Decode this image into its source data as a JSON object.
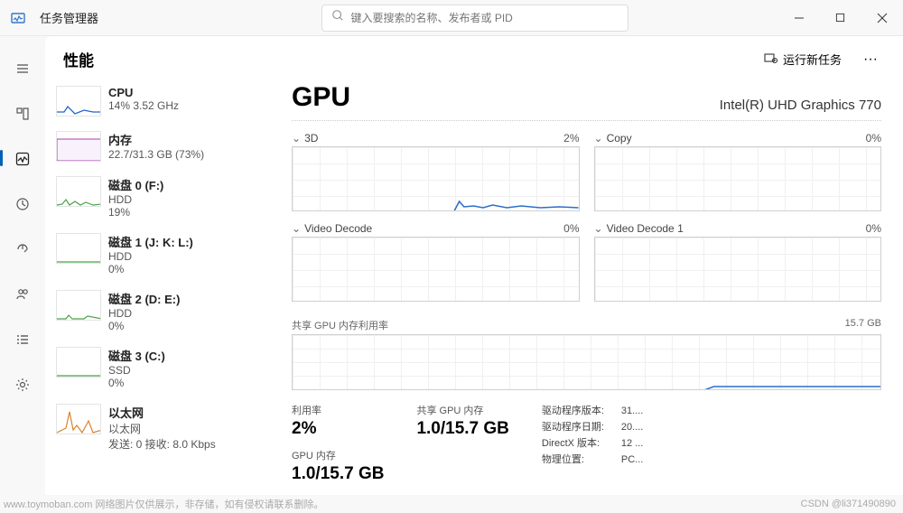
{
  "title": "任务管理器",
  "search": {
    "placeholder": "键入要搜索的名称、发布者或 PID"
  },
  "header": {
    "page_title": "性能",
    "run_new_task": "运行新任务",
    "more": "···"
  },
  "sidebar": [
    {
      "title": "CPU",
      "sub1": "14% 3.52 GHz",
      "sub2": "",
      "color": "#2067c7"
    },
    {
      "title": "内存",
      "sub1": "22.7/31.3 GB (73%)",
      "sub2": "",
      "color": "#a83fb3"
    },
    {
      "title": "磁盘 0 (F:)",
      "sub1": "HDD",
      "sub2": "19%",
      "color": "#4aa24a"
    },
    {
      "title": "磁盘 1 (J: K: L:)",
      "sub1": "HDD",
      "sub2": "0%",
      "color": "#4aa24a"
    },
    {
      "title": "磁盘 2 (D: E:)",
      "sub1": "HDD",
      "sub2": "0%",
      "color": "#4aa24a"
    },
    {
      "title": "磁盘 3 (C:)",
      "sub1": "SSD",
      "sub2": "0%",
      "color": "#4aa24a"
    },
    {
      "title": "以太网",
      "sub1": "以太网",
      "sub2": "发送: 0 接收: 8.0 Kbps",
      "color": "#d9822b"
    }
  ],
  "detail": {
    "title": "GPU",
    "model": "Intel(R) UHD Graphics 770",
    "charts": [
      {
        "name": "3D",
        "pct": "2%"
      },
      {
        "name": "Copy",
        "pct": "0%"
      },
      {
        "name": "Video Decode",
        "pct": "0%"
      },
      {
        "name": "Video Decode 1",
        "pct": "0%"
      }
    ],
    "shared": {
      "label": "共享 GPU 内存利用率",
      "cap": "15.7 GB"
    },
    "stats": [
      {
        "label": "利用率",
        "value": "2%"
      },
      {
        "label": "共享 GPU 内存",
        "value": "1.0/15.7 GB"
      }
    ],
    "stats2": [
      {
        "label": "GPU 内存",
        "value": "1.0/15.7 GB"
      }
    ],
    "props": [
      {
        "k": "驱动程序版本:",
        "v": "31...."
      },
      {
        "k": "驱动程序日期:",
        "v": "20...."
      },
      {
        "k": "DirectX 版本:",
        "v": "12 ..."
      },
      {
        "k": "物理位置:",
        "v": "PC..."
      }
    ]
  },
  "watermark": "www.toymoban.com 网络图片仅供展示，非存储，如有侵权请联系删除。",
  "credit": "CSDN @li371490890",
  "chart_data": {
    "type": "area",
    "title": "GPU engine utilization over 60s",
    "x_range_seconds": 60,
    "y_unit": "%",
    "series": [
      {
        "name": "3D",
        "ylim": [
          0,
          100
        ],
        "values": [
          0,
          0,
          0,
          0,
          0,
          0,
          0,
          0,
          0,
          0,
          0,
          0,
          0,
          0,
          0,
          0,
          0,
          0,
          0,
          0,
          0,
          0,
          0,
          0,
          0,
          0,
          0,
          0,
          0,
          0,
          0,
          0,
          0,
          0,
          0,
          8,
          3,
          5,
          4,
          6,
          4,
          5,
          3,
          4,
          5,
          4,
          3,
          5,
          4,
          4,
          3,
          5,
          3,
          4,
          5,
          4,
          3,
          4,
          4,
          2
        ]
      },
      {
        "name": "Copy",
        "ylim": [
          0,
          100
        ],
        "values": [
          0,
          0,
          0,
          0,
          0,
          0,
          0,
          0,
          0,
          0,
          0,
          0,
          0,
          0,
          0,
          0,
          0,
          0,
          0,
          0,
          0,
          0,
          0,
          0,
          0,
          0,
          0,
          0,
          0,
          0,
          0,
          0,
          0,
          0,
          0,
          0,
          0,
          0,
          0,
          0,
          0,
          0,
          0,
          0,
          0,
          0,
          0,
          0,
          0,
          0,
          0,
          0,
          0,
          0,
          0,
          0,
          0,
          0,
          0,
          0
        ]
      },
      {
        "name": "Video Decode",
        "ylim": [
          0,
          100
        ],
        "values": [
          0,
          0,
          0,
          0,
          0,
          0,
          0,
          0,
          0,
          0,
          0,
          0,
          0,
          0,
          0,
          0,
          0,
          0,
          0,
          0,
          0,
          0,
          0,
          0,
          0,
          0,
          0,
          0,
          0,
          0,
          0,
          0,
          0,
          0,
          0,
          0,
          0,
          0,
          0,
          0,
          0,
          0,
          0,
          0,
          0,
          0,
          0,
          0,
          0,
          0,
          0,
          0,
          0,
          0,
          0,
          0,
          0,
          0,
          0,
          0
        ]
      },
      {
        "name": "Video Decode 1",
        "ylim": [
          0,
          100
        ],
        "values": [
          0,
          0,
          0,
          0,
          0,
          0,
          0,
          0,
          0,
          0,
          0,
          0,
          0,
          0,
          0,
          0,
          0,
          0,
          0,
          0,
          0,
          0,
          0,
          0,
          0,
          0,
          0,
          0,
          0,
          0,
          0,
          0,
          0,
          0,
          0,
          0,
          0,
          0,
          0,
          0,
          0,
          0,
          0,
          0,
          0,
          0,
          0,
          0,
          0,
          0,
          0,
          0,
          0,
          0,
          0,
          0,
          0,
          0,
          0,
          0
        ]
      },
      {
        "name": "Shared GPU memory",
        "ylim": [
          0,
          15.7
        ],
        "unit": "GB",
        "values": [
          0,
          0,
          0,
          0,
          0,
          0,
          0,
          0,
          0,
          0,
          0,
          0,
          0,
          0,
          0,
          0,
          0,
          0,
          0,
          0,
          0,
          0,
          0,
          0,
          0,
          0,
          0,
          0,
          0,
          0,
          0,
          0,
          0,
          0,
          0,
          0,
          0,
          0,
          0,
          0,
          0,
          0,
          0,
          1.0,
          1.0,
          1.0,
          1.0,
          1.0,
          1.0,
          1.0,
          1.0,
          1.0,
          1.0,
          1.0,
          1.0,
          1.0,
          1.0,
          1.0,
          1.0,
          1.0
        ]
      }
    ]
  }
}
